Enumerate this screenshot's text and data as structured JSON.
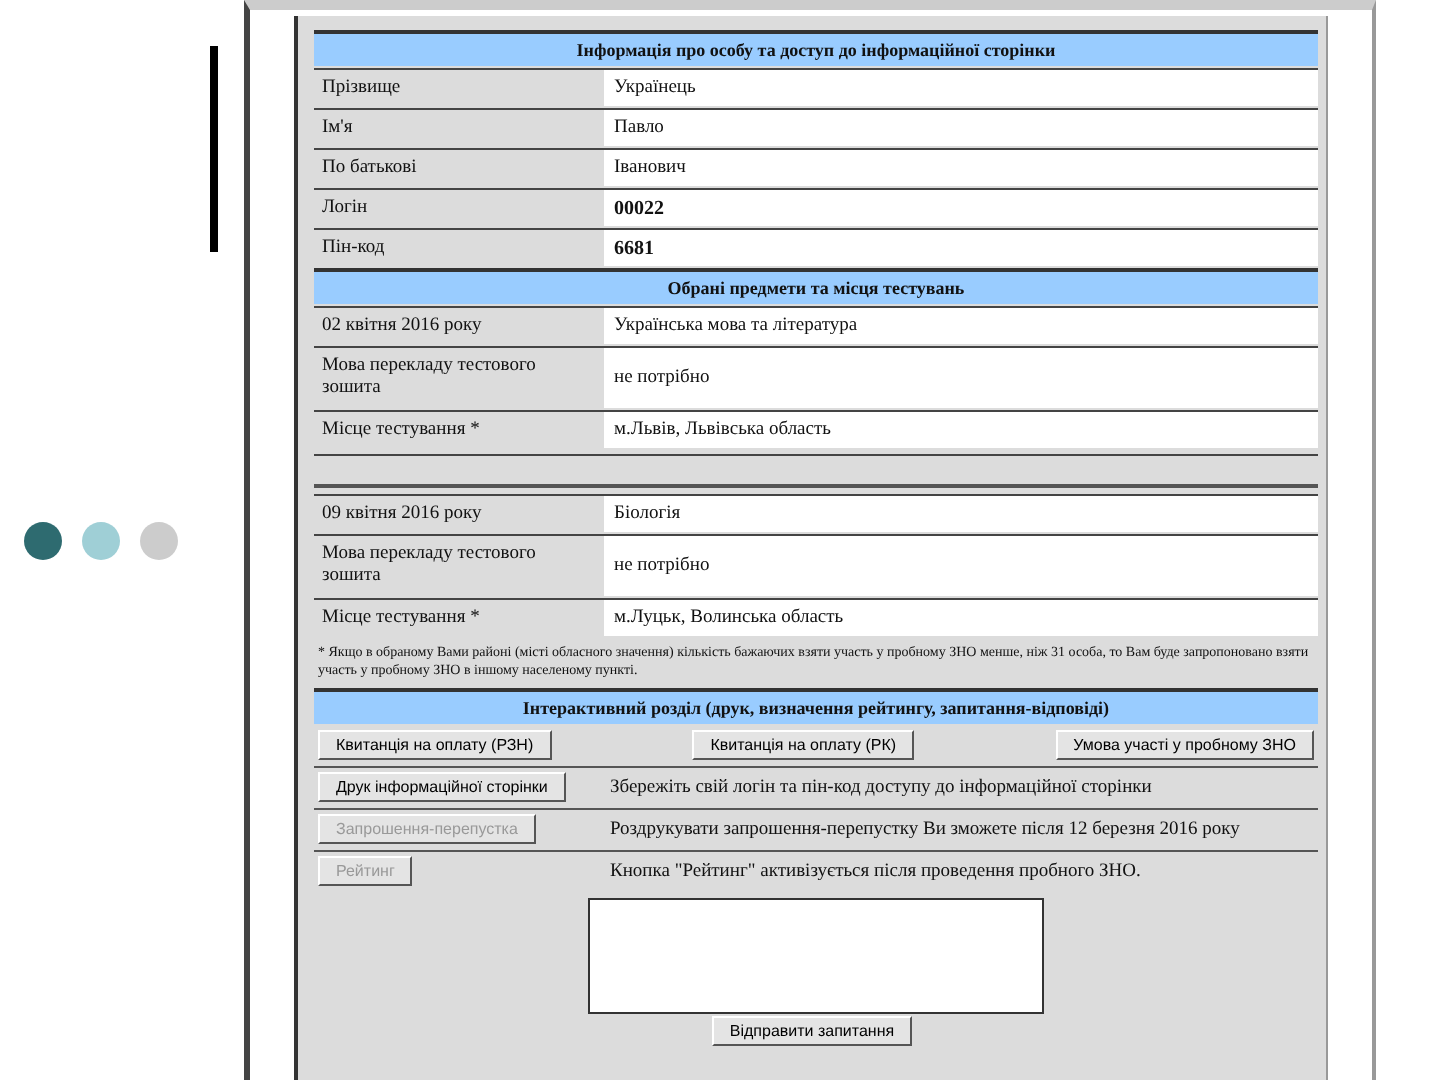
{
  "slide": {
    "dots": [
      {
        "color": "#2e6b70"
      },
      {
        "color": "#9fcfd6"
      },
      {
        "color": "#cccccc"
      }
    ]
  },
  "personal": {
    "title": "Інформація про особу та доступ до інформаційної сторінки",
    "rows": [
      {
        "label": "Прізвище",
        "value": "Українець",
        "kind": "plain"
      },
      {
        "label": "Ім'я",
        "value": "Павло",
        "kind": "plain"
      },
      {
        "label": "По батькові",
        "value": "Іванович",
        "kind": "plain"
      },
      {
        "label": "Логін",
        "value": "00022",
        "kind": "code"
      },
      {
        "label": "Пін-код",
        "value": "6681",
        "kind": "code"
      }
    ]
  },
  "subjects": {
    "title": "Обрані предмети та місця тестувань",
    "groups": [
      {
        "rows": [
          {
            "label": "02 квітня 2016 року",
            "value": "Українська мова та література"
          },
          {
            "label": "Мова перекладу тестового зошита",
            "value": "не потрібно"
          },
          {
            "label": "Місце тестування *",
            "value": "м.Львів, Львівська область"
          }
        ]
      },
      {
        "rows": [
          {
            "label": "09 квітня 2016 року",
            "value": "Біологія"
          },
          {
            "label": "Мова перекладу тестового зошита",
            "value": "не потрібно"
          },
          {
            "label": "Місце тестування *",
            "value": "м.Луцьк, Волинська область"
          }
        ]
      }
    ],
    "footnote": "* Якщо в обраному Вами районі (місті обласного значення) кількість бажаючих взяти участь у пробному ЗНО менше, ніж 31 особа, то Вам буде запропоновано взяти участь у пробному ЗНО в іншому населеному пункті."
  },
  "interactive": {
    "title": "Інтерактивний розділ (друк, визначення рейтингу, запитання-відповіді)",
    "top_buttons": [
      {
        "label": "Квитанція на оплату (РЗН)",
        "disabled": false
      },
      {
        "label": "Квитанція на оплату (РК)",
        "disabled": false
      },
      {
        "label": "Умова участі у пробному ЗНО",
        "disabled": false
      }
    ],
    "actions": [
      {
        "button": "Друк інформаційної сторінки",
        "disabled": false,
        "note": "Збережіть свій логін та пін-код доступу до інформаційної сторінки"
      },
      {
        "button": "Запрошення-перепустка",
        "disabled": true,
        "note": "Роздрукувати запрошення-перепустку Ви зможете після 12 березня 2016 року"
      },
      {
        "button": "Рейтинг",
        "disabled": true,
        "note": "Кнопка \"Рейтинг\" активізується після проведення пробного ЗНО."
      }
    ],
    "send_button": "Відправити запитання"
  }
}
